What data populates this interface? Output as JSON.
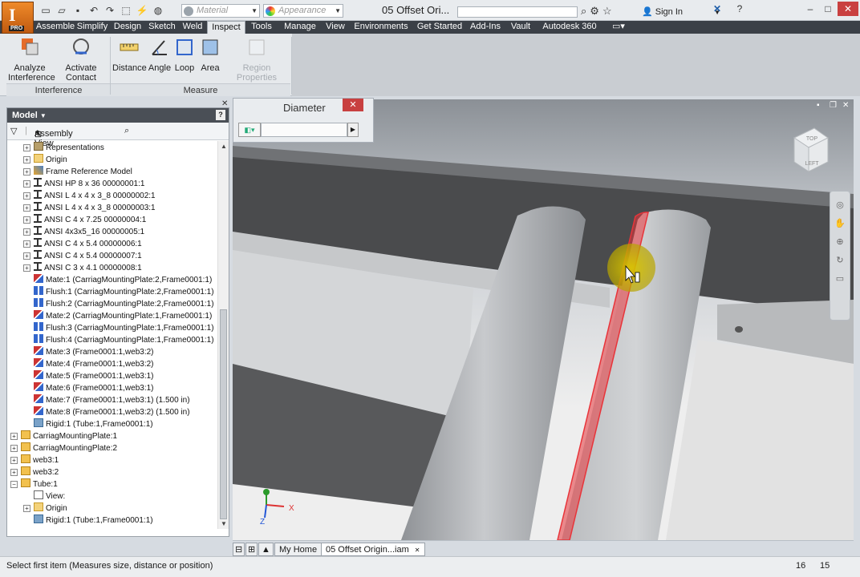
{
  "title": {
    "document": "05 Offset Ori...",
    "material_placeholder": "Material",
    "appearance_placeholder": "Appearance",
    "sign_in": "Sign In",
    "app_badge": "PRO"
  },
  "menu_tabs": [
    "Assemble",
    "Simplify",
    "Design",
    "Sketch",
    "Weld",
    "Inspect",
    "Tools",
    "Manage",
    "View",
    "Environments",
    "Get Started",
    "Add-Ins",
    "Vault",
    "Autodesk 360"
  ],
  "active_tab": "Inspect",
  "ribbon": {
    "interference": {
      "label": "Interference",
      "buttons": [
        {
          "line1": "Analyze",
          "line2": "Interference"
        },
        {
          "line1": "Activate",
          "line2": "Contact Solver"
        }
      ]
    },
    "measure": {
      "label": "Measure",
      "buttons": [
        "Distance",
        "Angle",
        "Loop",
        "Area"
      ],
      "disabled_button": "Region Properties"
    }
  },
  "browser": {
    "header": "Model",
    "view_label": "Assembly View",
    "help": "?",
    "items": [
      {
        "text": "Representations",
        "icon": "rep",
        "level": 2,
        "exp": "+"
      },
      {
        "text": "Origin",
        "icon": "folder",
        "level": 2,
        "exp": "+"
      },
      {
        "text": "Frame Reference Model",
        "icon": "frame",
        "level": 2,
        "exp": "+"
      },
      {
        "text": "ANSI HP 8 x 36 00000001:1",
        "icon": "ibeam",
        "level": 2,
        "exp": "+"
      },
      {
        "text": "ANSI L 4 x 4 x 3_8 00000002:1",
        "icon": "ibeam",
        "level": 2,
        "exp": "+"
      },
      {
        "text": "ANSI L 4 x 4 x 3_8 00000003:1",
        "icon": "ibeam",
        "level": 2,
        "exp": "+"
      },
      {
        "text": "ANSI C 4 x 7.25 00000004:1",
        "icon": "ibeam",
        "level": 2,
        "exp": "+"
      },
      {
        "text": "ANSI 4x3x5_16 00000005:1",
        "icon": "ibeam",
        "level": 2,
        "exp": "+"
      },
      {
        "text": "ANSI C 4 x 5.4 00000006:1",
        "icon": "ibeam",
        "level": 2,
        "exp": "+"
      },
      {
        "text": "ANSI C 4 x 5.4 00000007:1",
        "icon": "ibeam",
        "level": 2,
        "exp": "+"
      },
      {
        "text": "ANSI C 3 x 4.1 00000008:1",
        "icon": "ibeam",
        "level": 2,
        "exp": "+"
      },
      {
        "text": "Mate:1 (CarriagMountingPlate:2,Frame0001:1)",
        "icon": "mate",
        "level": 2,
        "exp": ""
      },
      {
        "text": "Flush:1 (CarriagMountingPlate:2,Frame0001:1)",
        "icon": "flush",
        "level": 2,
        "exp": ""
      },
      {
        "text": "Flush:2 (CarriagMountingPlate:2,Frame0001:1)",
        "icon": "flush",
        "level": 2,
        "exp": ""
      },
      {
        "text": "Mate:2 (CarriagMountingPlate:1,Frame0001:1)",
        "icon": "mate",
        "level": 2,
        "exp": ""
      },
      {
        "text": "Flush:3 (CarriagMountingPlate:1,Frame0001:1)",
        "icon": "flush",
        "level": 2,
        "exp": ""
      },
      {
        "text": "Flush:4 (CarriagMountingPlate:1,Frame0001:1)",
        "icon": "flush",
        "level": 2,
        "exp": ""
      },
      {
        "text": "Mate:3 (Frame0001:1,web3:2)",
        "icon": "mate",
        "level": 2,
        "exp": ""
      },
      {
        "text": "Mate:4 (Frame0001:1,web3:2)",
        "icon": "mate",
        "level": 2,
        "exp": ""
      },
      {
        "text": "Mate:5 (Frame0001:1,web3:1)",
        "icon": "mate",
        "level": 2,
        "exp": ""
      },
      {
        "text": "Mate:6 (Frame0001:1,web3:1)",
        "icon": "mate",
        "level": 2,
        "exp": ""
      },
      {
        "text": "Mate:7 (Frame0001:1,web3:1) (1.500 in)",
        "icon": "mate",
        "level": 2,
        "exp": ""
      },
      {
        "text": "Mate:8 (Frame0001:1,web3:2) (1.500 in)",
        "icon": "mate",
        "level": 2,
        "exp": ""
      },
      {
        "text": "Rigid:1 (Tube:1,Frame0001:1)",
        "icon": "rigid",
        "level": 2,
        "exp": ""
      },
      {
        "text": "CarriagMountingPlate:1",
        "icon": "part",
        "level": 1,
        "exp": "+"
      },
      {
        "text": "CarriagMountingPlate:2",
        "icon": "part",
        "level": 1,
        "exp": "+"
      },
      {
        "text": "web3:1",
        "icon": "part",
        "level": 1,
        "exp": "+"
      },
      {
        "text": "web3:2",
        "icon": "part",
        "level": 1,
        "exp": "+"
      },
      {
        "text": "Tube:1",
        "icon": "part",
        "level": 1,
        "exp": "−"
      },
      {
        "text": "View:",
        "icon": "view",
        "level": 2,
        "exp": ""
      },
      {
        "text": "Origin",
        "icon": "folder",
        "level": 2,
        "exp": "+"
      },
      {
        "text": "Rigid:1 (Tube:1,Frame0001:1)",
        "icon": "rigid",
        "level": 2,
        "exp": ""
      }
    ]
  },
  "mini_dialog": {
    "title": "Diameter",
    "value": ""
  },
  "viewcube": {
    "top": "TOP",
    "left": "LEFT"
  },
  "triad": {
    "x": "X",
    "y": "Y",
    "z": "Z"
  },
  "doc_tabs": [
    "My Home",
    "05 Offset Origin...iam"
  ],
  "status": {
    "message": "Select first item (Measures size, distance or position)",
    "num1": "16",
    "num2": "15"
  },
  "colors": {
    "highlight": "#e8343a",
    "accent": "#d36f1f",
    "menubar": "#3b4047"
  }
}
